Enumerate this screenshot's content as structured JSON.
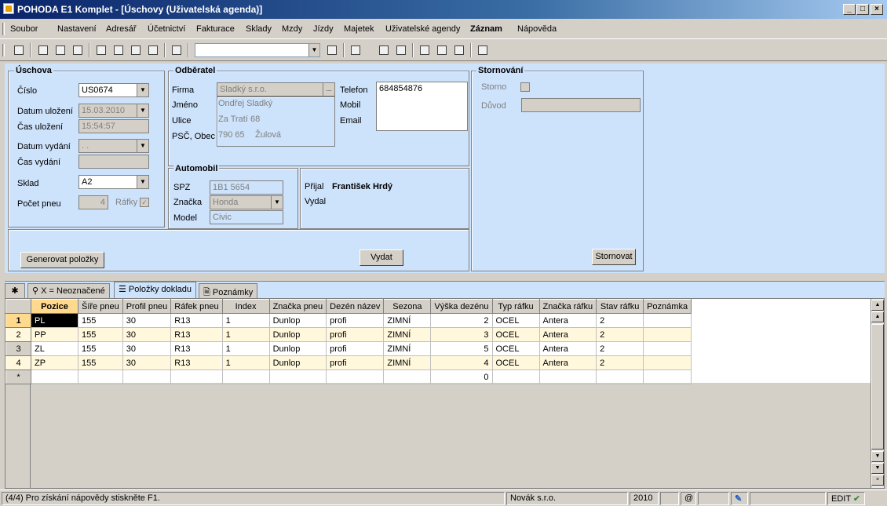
{
  "window": {
    "title": "POHODA E1 Komplet - [Úschovy (Uživatelská agenda)]",
    "btn_min": "_",
    "btn_max": "□",
    "btn_close": "×"
  },
  "menu": [
    "Soubor",
    "Nastavení",
    "Adresář",
    "Účetnictví",
    "Fakturace",
    "Sklady",
    "Mzdy",
    "Jízdy",
    "Majetek",
    "Uživatelské agendy",
    "Záznam",
    "Nápověda"
  ],
  "uschova": {
    "title": "Úschova",
    "cislo_label": "Číslo",
    "cislo": "US0674",
    "datum_ulozeni_label": "Datum uložení",
    "datum_ulozeni": "15.03.2010",
    "cas_ulozeni_label": "Čas uložení",
    "cas_ulozeni": "15:54:57",
    "datum_vydani_label": "Datum vydání",
    "datum_vydani": " . .",
    "cas_vydani_label": "Čas vydání",
    "cas_vydani": "",
    "sklad_label": "Sklad",
    "sklad": "A2",
    "pocet_pneu_label": "Počet pneu",
    "pocet_pneu": "4",
    "rafky_label": "Ráfky",
    "rafky_check": "✓"
  },
  "odberatel": {
    "title": "Odběratel",
    "firma_label": "Firma",
    "firma": "Sladký s.r.o.",
    "firma_btn": "...",
    "jmeno_label": "Jméno",
    "jmeno": "Ondřej Sladký",
    "ulice_label": "Ulice",
    "ulice": "Za Tratí 68",
    "psc_label": "PSČ, Obec",
    "psc": "790 65",
    "obec": "Žulová",
    "telefon_label": "Telefon",
    "telefon": "684854876",
    "mobil_label": "Mobil",
    "email_label": "Email"
  },
  "automobil": {
    "title": "Automobil",
    "spz_label": "SPZ",
    "spz": "1B1 5654",
    "znacka_label": "Značka",
    "znacka": "Honda",
    "model_label": "Model",
    "model": "Civic"
  },
  "prijal": {
    "prijal_label": "Přijal",
    "prijal": "František Hrdý",
    "vydal_label": "Vydal"
  },
  "stornovani": {
    "title": "Stornování",
    "storno_label": "Storno",
    "duvod_label": "Důvod"
  },
  "buttons": {
    "generovat": "Generovat položky",
    "vydat": "Vydat",
    "stornovat": "Stornovat"
  },
  "tabs": {
    "star": "✱",
    "filter": "X = Neoznačené",
    "polozky": "Položky dokladu",
    "poznamky": "Poznámky"
  },
  "grid": {
    "columns": [
      "Pozice",
      "Šíře pneu",
      "Profil pneu",
      "Ráfek pneu",
      "Index",
      "Značka pneu",
      "Dezén název",
      "Sezona",
      "Výška dezénu",
      "Typ ráfku",
      "Značka ráfku",
      "Stav ráfku",
      "Poznámka"
    ],
    "rows": [
      {
        "n": "1",
        "cells": [
          "PL",
          "155",
          "30",
          "R13",
          "1",
          "Dunlop",
          "profi",
          "ZIMNÍ",
          "2",
          "OCEL",
          "Antera",
          "2",
          ""
        ]
      },
      {
        "n": "2",
        "cells": [
          "PP",
          "155",
          "30",
          "R13",
          "1",
          "Dunlop",
          "profi",
          "ZIMNÍ",
          "3",
          "OCEL",
          "Antera",
          "2",
          ""
        ]
      },
      {
        "n": "3",
        "cells": [
          "ZL",
          "155",
          "30",
          "R13",
          "1",
          "Dunlop",
          "profi",
          "ZIMNÍ",
          "5",
          "OCEL",
          "Antera",
          "2",
          ""
        ]
      },
      {
        "n": "4",
        "cells": [
          "ZP",
          "155",
          "30",
          "R13",
          "1",
          "Dunlop",
          "profi",
          "ZIMNÍ",
          "4",
          "OCEL",
          "Antera",
          "2",
          ""
        ]
      },
      {
        "n": "*",
        "cells": [
          "",
          "",
          "",
          "",
          "",
          "",
          "",
          "",
          "0",
          "",
          "",
          "",
          ""
        ]
      }
    ]
  },
  "status": {
    "help": "(4/4) Pro získání nápovědy stiskněte F1.",
    "company": "Novák s.r.o.",
    "year": "2010",
    "at": "@",
    "mode": "EDIT"
  }
}
